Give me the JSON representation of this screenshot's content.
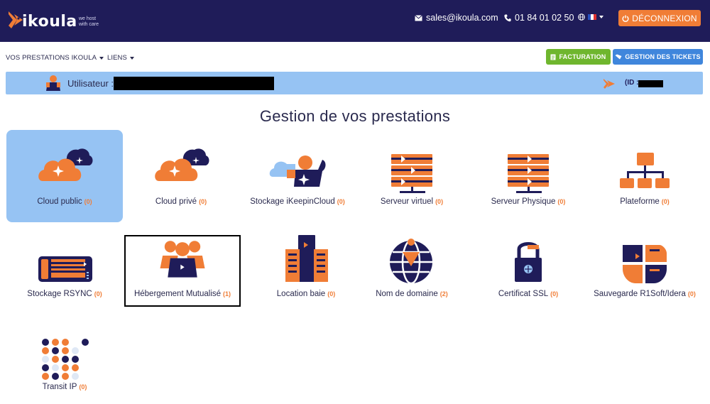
{
  "brand": {
    "name": "ikoula",
    "tagline_line1": "we host",
    "tagline_line2": "with care"
  },
  "topbar": {
    "email": "sales@ikoula.com",
    "phone": "01 84 01 02 50",
    "logout_label": "DÉCONNEXION"
  },
  "nav": {
    "menu1": "VOS PRESTATIONS IKOULA",
    "menu2": "LIENS",
    "billing_label": "FACTURATION",
    "tickets_label": "GESTION DES TICKETS"
  },
  "user": {
    "label": "Utilisateur :",
    "id_label": "(ID :"
  },
  "page": {
    "title": "Gestion de vos prestations"
  },
  "services": [
    {
      "label": "Cloud public",
      "count": "(0)",
      "icon": "cloud-icon"
    },
    {
      "label": "Cloud privé",
      "count": "(0)",
      "icon": "cloud-icon"
    },
    {
      "label": "Stockage iKeepinCloud",
      "count": "(0)",
      "icon": "cloud-storage-icon"
    },
    {
      "label": "Serveur virtuel",
      "count": "(0)",
      "icon": "server-icon"
    },
    {
      "label": "Serveur Physique",
      "count": "(0)",
      "icon": "server-icon"
    },
    {
      "label": "Plateforme",
      "count": "(0)",
      "icon": "platform-icon"
    },
    {
      "label": "Stockage RSYNC",
      "count": "(0)",
      "icon": "storage-device-icon"
    },
    {
      "label": "Hébergement Mutualisé",
      "count": "(1)",
      "icon": "shared-hosting-icon"
    },
    {
      "label": "Location baie",
      "count": "(0)",
      "icon": "rack-icon"
    },
    {
      "label": "Nom de domaine",
      "count": "(2)",
      "icon": "globe-icon"
    },
    {
      "label": "Certificat SSL",
      "count": "(0)",
      "icon": "lock-icon"
    },
    {
      "label": "Sauvegarde R1Soft/Idera",
      "count": "(0)",
      "icon": "backup-icon"
    },
    {
      "label": "Transit IP",
      "count": "(0)",
      "icon": "dot-grid-icon"
    }
  ],
  "colors": {
    "navy": "#1f1c59",
    "orange": "#f07d36",
    "light_blue": "#96c3f3",
    "green": "#6fb62e",
    "blue": "#3f86dc"
  }
}
